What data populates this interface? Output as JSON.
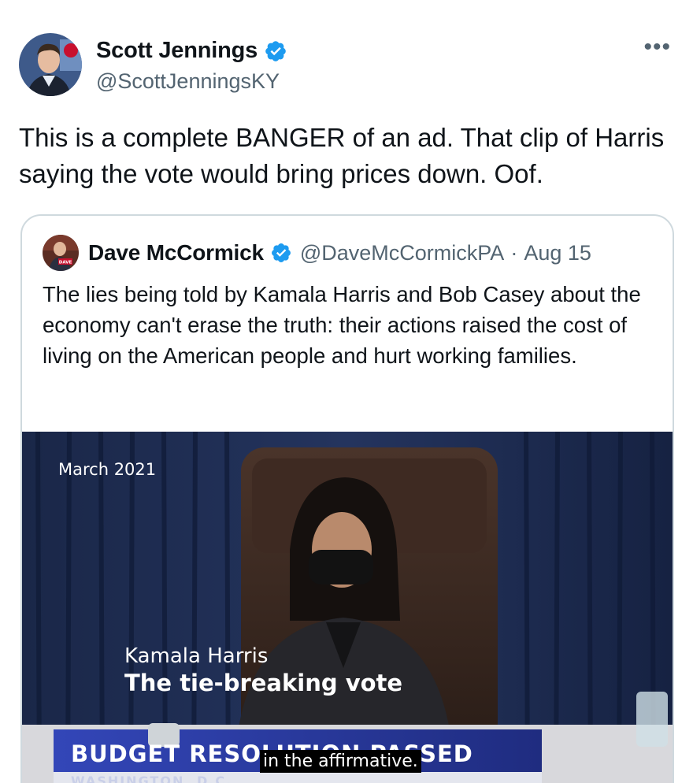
{
  "author": {
    "display_name": "Scott Jennings",
    "handle": "@ScottJenningsKY",
    "verified_icon": "verified-badge-icon",
    "avatar_icon": "profile-photo"
  },
  "more_options_icon": "more-horizontal-icon",
  "tweet": {
    "text": "This is a complete BANGER of an ad. That clip of Harris saying the vote would bring prices down. Oof."
  },
  "quote": {
    "display_name": "Dave McCormick",
    "handle": "@DaveMcCormickPA",
    "separator": "·",
    "date": "Aug 15",
    "text": "The lies being told by Kamala Harris and Bob Casey about the economy can't erase the truth: their actions raised the cost of living on the American people and hurt working families.",
    "avatar_label": "DAVE",
    "media": {
      "date_tag": "March 2021",
      "lower_third_name": "Kamala Harris",
      "lower_third_title": "The tie-breaking vote",
      "chyron": "BUDGET RESOLUTION PASSED",
      "chyron_sub": "WASHINGTON, D.C.",
      "caption": "in the affirmative."
    }
  },
  "colors": {
    "verified": "#1d9bf0",
    "secondary_text": "#536471",
    "border": "#cfd9de",
    "curtain": "#1c2a4e",
    "chyron": "#2a3a9e"
  }
}
